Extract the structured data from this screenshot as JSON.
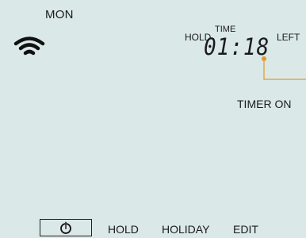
{
  "display": {
    "day": "MON",
    "hold_top_label": "HOLD",
    "time_label": "TIME",
    "time_value": "01:18",
    "left_label": "LEFT",
    "timer_status": "TIMER ON"
  },
  "icons": {
    "wifi": "wifi-icon",
    "power": "power-icon"
  },
  "buttons": {
    "hold": "HOLD",
    "holiday": "HOLIDAY",
    "edit": "EDIT"
  },
  "colors": {
    "background": "#dae8e7",
    "text": "#1b1b1b",
    "accent": "#e39a2c"
  }
}
